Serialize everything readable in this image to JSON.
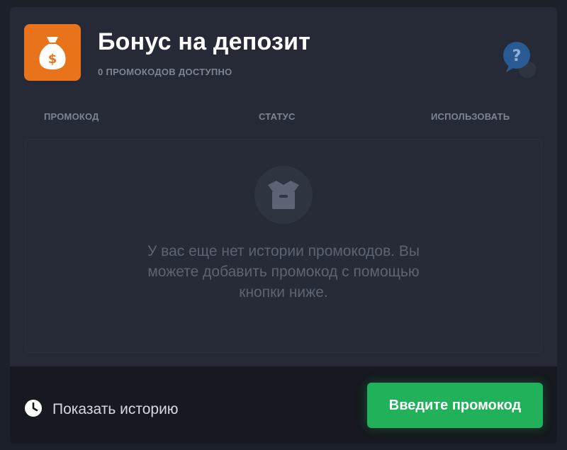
{
  "header": {
    "title": "Бонус на депозит",
    "subtitle": "0 ПРОМОКОДОВ ДОСТУПНО",
    "icon": "money-bag-icon",
    "help_icon": "question-chat-icon",
    "help_symbol": "?"
  },
  "table": {
    "columns": [
      "ПРОМОКОД",
      "СТАТУС",
      "ИСПОЛЬЗОВАТЬ"
    ]
  },
  "empty_state": {
    "icon": "open-box-icon",
    "message": "У вас еще нет истории промокодов. Вы можете добавить промокод с помощью кнопки ниже."
  },
  "footer": {
    "history_icon": "clock-icon",
    "history_label": "Показать историю",
    "enter_promo_label": "Введите промокод"
  },
  "colors": {
    "accent_orange": "#e8731a",
    "button_green": "#20b15a",
    "card_bg": "#252a36",
    "footer_bg": "#16191f"
  }
}
